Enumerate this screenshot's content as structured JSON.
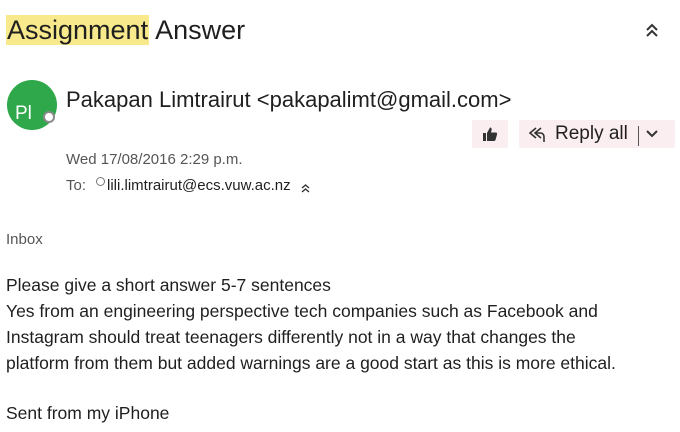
{
  "email": {
    "subject_highlight": "Assignment",
    "subject_rest": " Answer",
    "sender_initials": "Pl",
    "sender": "Pakapan Limtrairut <pakapalimt@gmail.com>",
    "date": "Wed 17/08/2016 2:29 p.m.",
    "to_label": "To:",
    "recipient": "lili.limtrairut@ecs.vuw.ac.nz",
    "folder": "Inbox",
    "body_lines": [
      "Please give a short answer 5-7 sentences",
      "Yes from an engineering perspective tech companies such as Facebook and",
      "Instagram should treat teenagers differently not in a way that changes the",
      "platform from them but added warnings are a good start as this is more ethical."
    ],
    "signature": "Sent from my iPhone"
  },
  "actions": {
    "reply_all_label": "Reply all",
    "like_icon": "thumbs-up-icon",
    "reply_all_icon": "reply-all-icon",
    "dropdown_icon": "chevron-down-icon",
    "collapse_icon": "double-chevron-up-icon"
  },
  "colors": {
    "avatar": "#2ea84a",
    "highlight": "#f7e98c",
    "button_bg": "#fbeef0"
  }
}
